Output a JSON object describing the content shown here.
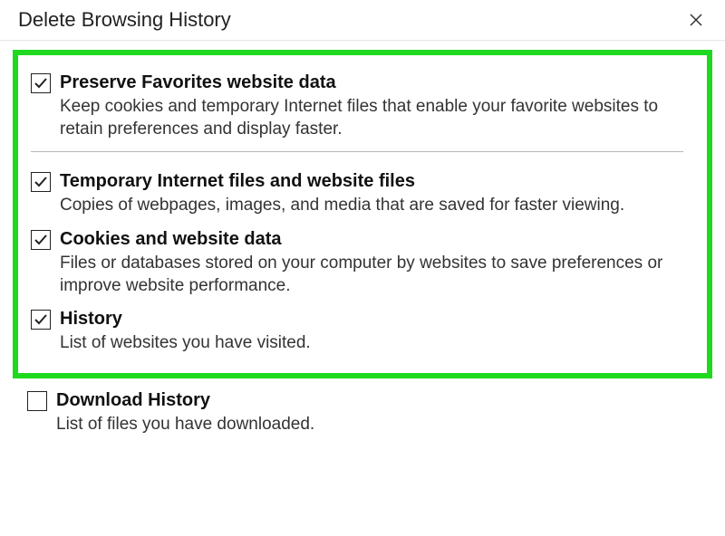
{
  "window": {
    "title": "Delete Browsing History"
  },
  "options": {
    "preserveFavorites": {
      "checked": true,
      "title": "Preserve Favorites website data",
      "desc": "Keep cookies and temporary Internet files that enable your favorite websites to retain preferences and display faster."
    },
    "tempFiles": {
      "checked": true,
      "title": "Temporary Internet files and website files",
      "desc": "Copies of webpages, images, and media that are saved for faster viewing."
    },
    "cookies": {
      "checked": true,
      "title": "Cookies and website data",
      "desc": "Files or databases stored on your computer by websites to save preferences or improve website performance."
    },
    "history": {
      "checked": true,
      "title": "History",
      "desc": "List of websites you have visited."
    },
    "downloadHistory": {
      "checked": false,
      "title": "Download History",
      "desc": "List of files you have downloaded."
    }
  },
  "highlight_color": "#1ed91e"
}
